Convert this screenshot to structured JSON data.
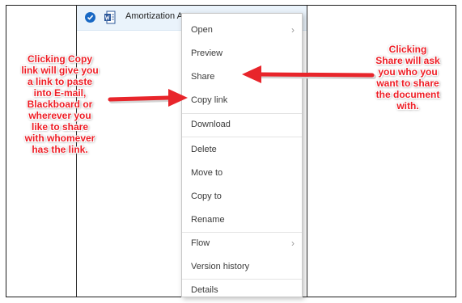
{
  "file": {
    "name": "Amortization A",
    "check_icon": "checkmark-circle-icon",
    "file_icon": "word-document-icon"
  },
  "menu": {
    "items": [
      {
        "label": "Open",
        "submenu": true
      },
      {
        "label": "Preview",
        "submenu": false
      },
      {
        "label": "Share",
        "submenu": false
      },
      {
        "label": "Copy link",
        "submenu": false
      },
      {
        "label": "Download",
        "submenu": false
      },
      {
        "label": "Delete",
        "submenu": false
      },
      {
        "label": "Move to",
        "submenu": false
      },
      {
        "label": "Copy to",
        "submenu": false
      },
      {
        "label": "Rename",
        "submenu": false
      },
      {
        "label": "Flow",
        "submenu": true
      },
      {
        "label": "Version history",
        "submenu": false
      },
      {
        "label": "Details",
        "submenu": false
      }
    ],
    "chevron_icon": "chevron-right-icon"
  },
  "annotations": {
    "left": [
      "Clicking Copy",
      "link will give you",
      "a link to paste",
      "into E-mail,",
      "Blackboard or",
      "wherever you",
      "like to share",
      "with whomever",
      "has the link."
    ],
    "right": [
      "Clicking",
      "Share will ask",
      "you who you",
      "want to share",
      "the document",
      "with."
    ]
  },
  "colors": {
    "annotation_red": "#ee1c24",
    "arrow_red": "#e8252b",
    "selection_blue": "#1868c4"
  }
}
